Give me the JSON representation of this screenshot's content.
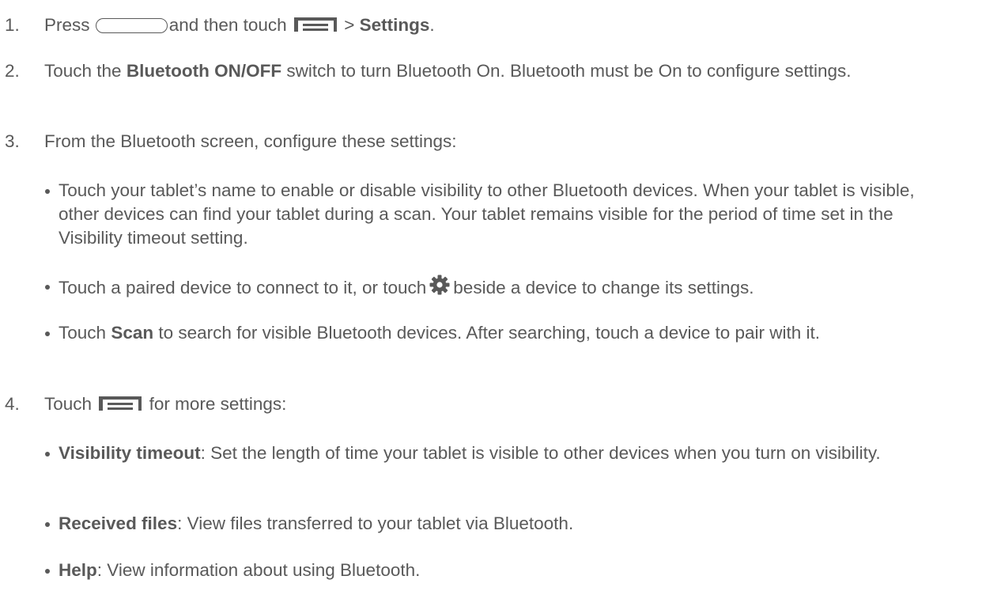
{
  "steps": [
    {
      "number": "1.",
      "text_a": "Press",
      "text_b": "and then touch",
      "text_c": ">",
      "bold_settings": "Settings",
      "text_d": ".",
      "home_key_icon": "home-key-icon",
      "menu_key_icon": "menu-key-icon"
    },
    {
      "number": "2.",
      "text_a": "Touch the",
      "bold_switch": "Bluetooth ON/OFF",
      "text_b": "switch to turn Bluetooth On. Bluetooth must be On to configure settings."
    },
    {
      "number": "3.",
      "text": "From the Bluetooth screen, configure these settings:",
      "bullets": [
        {
          "text": "Touch your tablet’s name to enable or disable visibility to other Bluetooth devices. When your tablet is visible, other devices can find your tablet during a scan. Your tablet remains visible for the period of time set in the Visibility timeout setting."
        },
        {
          "text_a": "Touch a paired device to connect to it, or touch",
          "gear_icon": "gear-icon",
          "text_b": "beside a device to change its settings."
        },
        {
          "text_a": "Touch",
          "bold": "Scan",
          "text_b": "to search for visible Bluetooth devices. After searching, touch a device to pair with it."
        }
      ]
    },
    {
      "number": "4.",
      "text_a": "Touch",
      "text_b": "for more settings:",
      "menu_key_icon": "menu-key-icon",
      "bullets": [
        {
          "bold": "Visibility timeout",
          "text": ": Set the length of time your tablet is visible to other devices when you turn on visibility."
        },
        {
          "bold": "Received files",
          "text": ": View files transferred to your tablet via Bluetooth."
        },
        {
          "bold": "Help",
          "text": ": View information about using Bluetooth."
        }
      ]
    }
  ],
  "colors": {
    "text": "#595959",
    "background": "#ffffff"
  }
}
